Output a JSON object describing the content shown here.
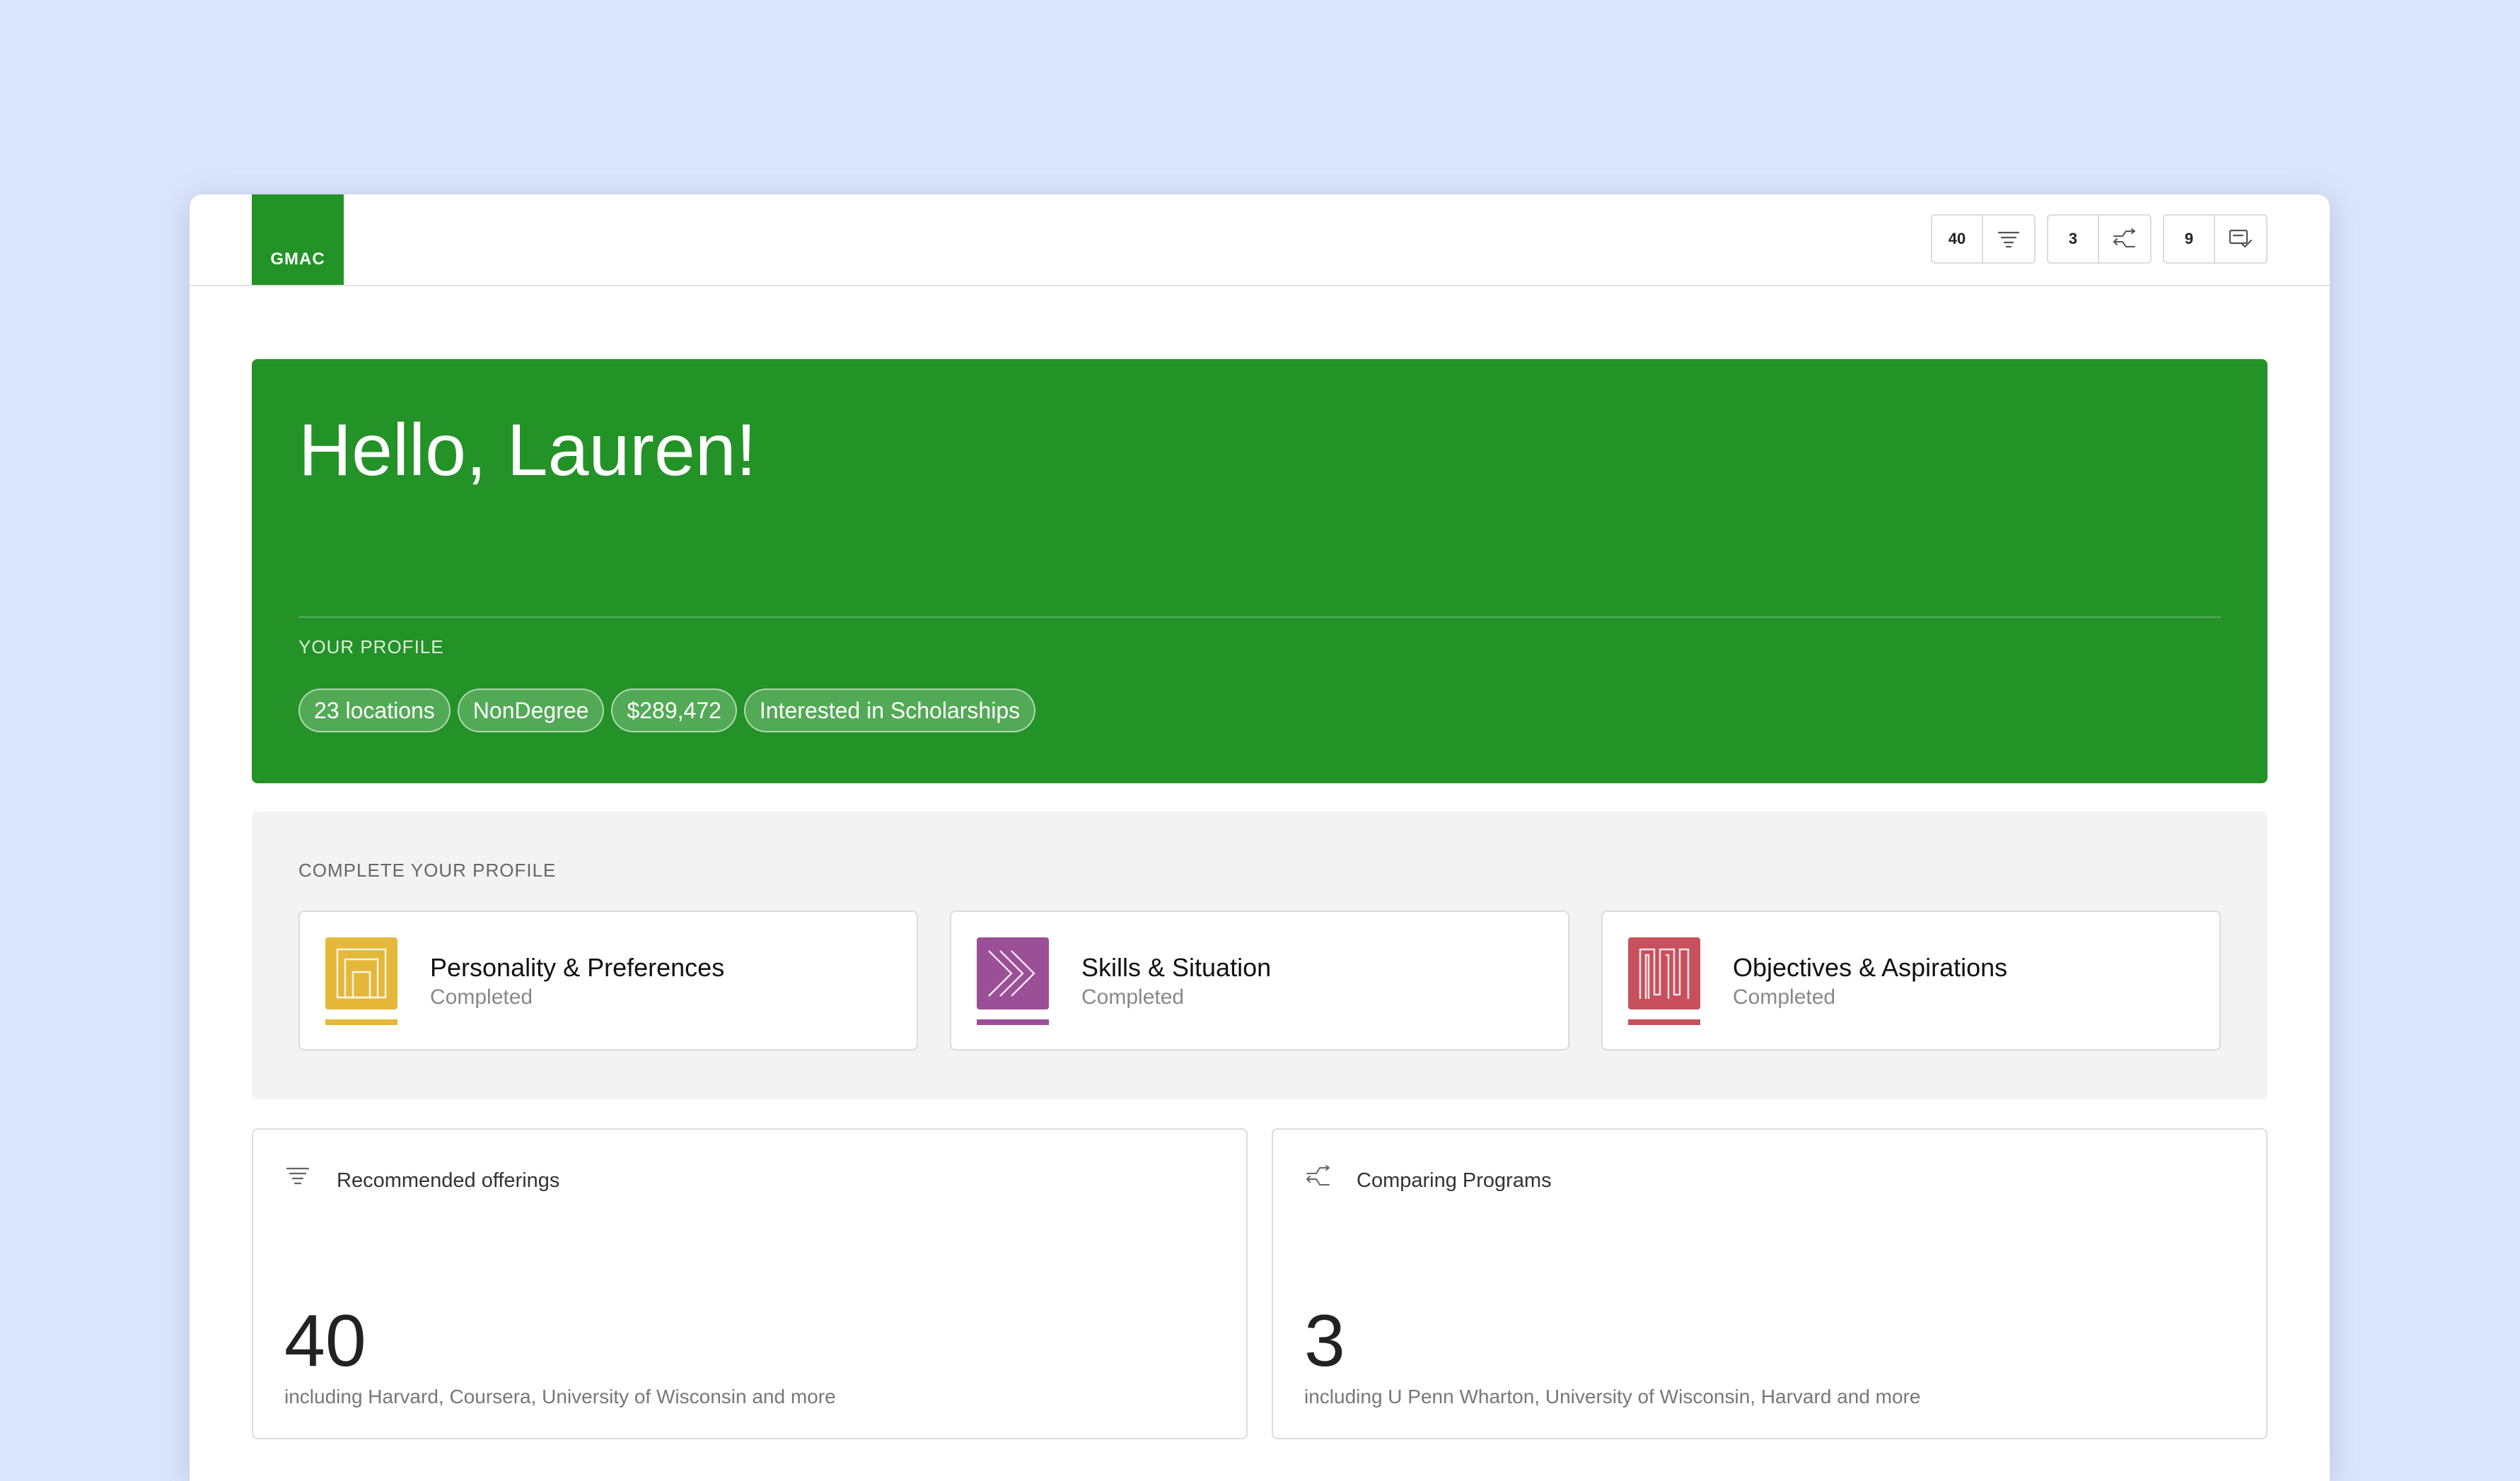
{
  "app": {
    "logo_text": "GMAC"
  },
  "topbar": {
    "counters": [
      {
        "count": "40",
        "icon": "filter-icon"
      },
      {
        "count": "3",
        "icon": "compare-arrows-icon"
      },
      {
        "count": "9",
        "icon": "checklist-icon"
      }
    ]
  },
  "hero": {
    "greeting": "Hello, Lauren!",
    "profile_label": "YOUR PROFILE",
    "tags": [
      "23 locations",
      "NonDegree",
      "$289,472",
      "Interested in Scholarships"
    ]
  },
  "complete_profile": {
    "label": "COMPLETE YOUR PROFILE",
    "cards": [
      {
        "title": "Personality & Preferences",
        "status": "Completed",
        "color": "#e5b83a",
        "icon": "nested-squares-icon"
      },
      {
        "title": "Skills & Situation",
        "status": "Completed",
        "color": "#9b4f97",
        "icon": "triple-chevron-icon"
      },
      {
        "title": "Objectives & Aspirations",
        "status": "Completed",
        "color": "#c84f5c",
        "icon": "wave-pattern-icon"
      }
    ]
  },
  "stats": [
    {
      "icon": "filter-icon",
      "title": "Recommended offerings",
      "number": "40",
      "subtitle": "including Harvard, Coursera, University of Wisconsin and more"
    },
    {
      "icon": "compare-arrows-icon",
      "title": "Comparing Programs",
      "number": "3",
      "subtitle": "including U Penn Wharton, University of Wisconsin, Harvard and more"
    }
  ],
  "colors": {
    "brand_green": "#239227",
    "background": "#dbe5fc"
  }
}
